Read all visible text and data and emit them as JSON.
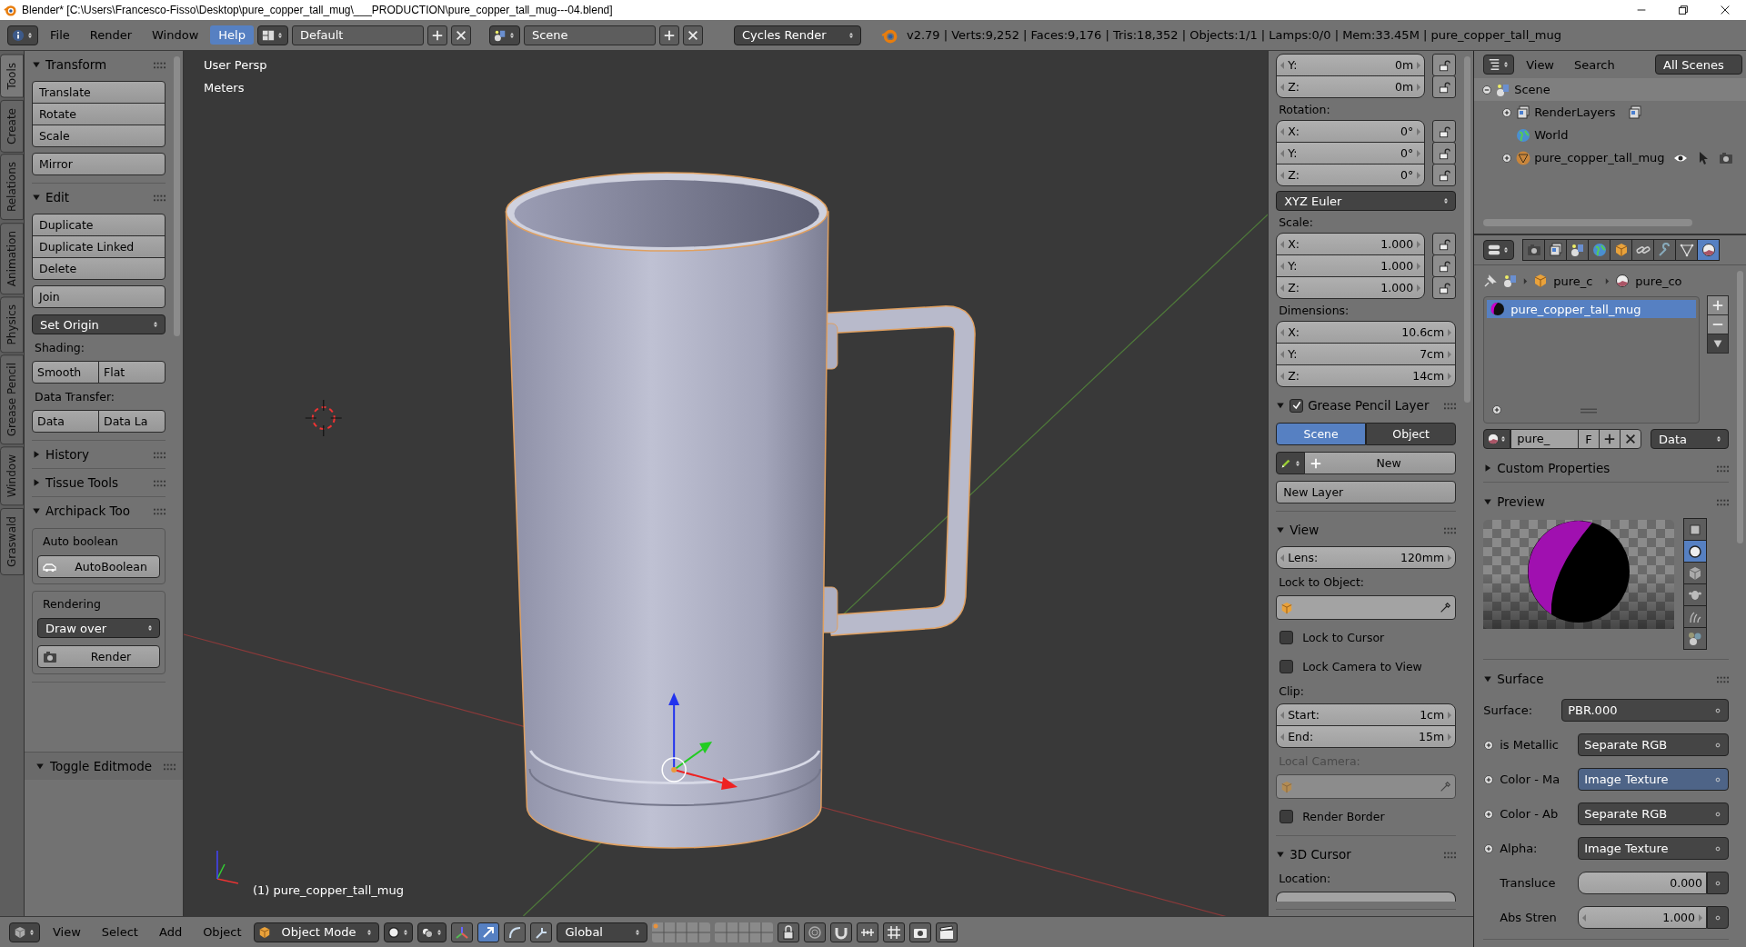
{
  "window": {
    "title": "Blender* [C:\\Users\\Francesco-Fisso\\Desktop\\pure_copper_tall_mug\\___PRODUCTION\\pure_copper_tall_mug---04.blend]"
  },
  "info_header": {
    "menus": [
      {
        "label": "File",
        "selected": false
      },
      {
        "label": "Render",
        "selected": false
      },
      {
        "label": "Window",
        "selected": false
      },
      {
        "label": "Help",
        "selected": true
      }
    ],
    "layout": "Default",
    "scene": "Scene",
    "engine": "Cycles Render",
    "stats": "v2.79 | Verts:9,252 | Faces:9,176 | Tris:18,352 | Objects:1/1 | Lamps:0/0 | Mem:33.45M | pure_copper_tall_mug"
  },
  "tool_tabs": [
    {
      "label": "Tools",
      "selected": true
    },
    {
      "label": "Create",
      "selected": false
    },
    {
      "label": "Relations",
      "selected": false
    },
    {
      "label": "Animation",
      "selected": false
    },
    {
      "label": "Physics",
      "selected": false
    },
    {
      "label": "Grease Pencil",
      "selected": false
    },
    {
      "label": "Window",
      "selected": false
    },
    {
      "label": "Graswald",
      "selected": false
    }
  ],
  "tool_shelf": {
    "panels": [
      {
        "title": "Transform",
        "expanded": true,
        "items": [
          {
            "kind": "stack",
            "buttons": [
              "Translate",
              "Rotate",
              "Scale"
            ]
          },
          {
            "kind": "stack",
            "buttons": [
              "Mirror"
            ]
          }
        ]
      },
      {
        "title": "Edit",
        "expanded": true,
        "items": [
          {
            "kind": "stack",
            "buttons": [
              "Duplicate",
              "Duplicate Linked",
              "Delete"
            ]
          },
          {
            "kind": "stack",
            "buttons": [
              "Join"
            ]
          },
          {
            "kind": "dropdown",
            "label": "Set Origin"
          },
          {
            "kind": "label",
            "label": "Shading:"
          },
          {
            "kind": "row",
            "buttons": [
              "Smooth",
              "Flat"
            ]
          },
          {
            "kind": "label",
            "label": "Data Transfer:"
          },
          {
            "kind": "row",
            "buttons": [
              "Data",
              "Data La"
            ]
          }
        ]
      },
      {
        "title": "History",
        "expanded": false
      },
      {
        "title": "Tissue Tools",
        "expanded": false
      },
      {
        "title": "Archipack Too",
        "expanded": true,
        "items": [
          {
            "kind": "box",
            "items": [
              {
                "kind": "label",
                "label": "Auto boolean"
              },
              {
                "kind": "icon_button",
                "label": "AutoBoolean"
              }
            ]
          },
          {
            "kind": "box",
            "items": [
              {
                "kind": "label",
                "label": "Rendering"
              },
              {
                "kind": "dropdown",
                "label": "Draw over"
              },
              {
                "kind": "icon_button",
                "label": "Render"
              }
            ]
          }
        ]
      }
    ]
  },
  "operator_panel": {
    "title": "Toggle Editmode",
    "expanded": true
  },
  "viewport": {
    "view_name": "User Persp",
    "units": "Meters",
    "object_label": "(1) pure_copper_tall_mug"
  },
  "properties_region": {
    "transform_items": [
      {
        "kind": "fields",
        "fields": [
          {
            "label": "Y:",
            "value": "0m",
            "locked": false
          },
          {
            "label": "Z:",
            "value": "0m",
            "locked": false
          }
        ]
      },
      {
        "kind": "label",
        "label": "Rotation:",
        "disabled": false
      },
      {
        "kind": "fields",
        "fields": [
          {
            "label": "X:",
            "value": "0°",
            "locked": false
          },
          {
            "label": "Y:",
            "value": "0°",
            "locked": false
          },
          {
            "label": "Z:",
            "value": "0°",
            "locked": false
          }
        ]
      },
      {
        "kind": "dropdown",
        "label": "XYZ Euler"
      },
      {
        "kind": "label",
        "label": "Scale:",
        "disabled": false
      },
      {
        "kind": "fields",
        "fields": [
          {
            "label": "X:",
            "value": "1.000",
            "locked": false
          },
          {
            "label": "Y:",
            "value": "1.000",
            "locked": false
          },
          {
            "label": "Z:",
            "value": "1.000",
            "locked": false
          }
        ]
      },
      {
        "kind": "label",
        "label": "Dimensions:",
        "disabled": false
      },
      {
        "kind": "fields",
        "fields": [
          {
            "label": "X:",
            "value": "10.6cm"
          },
          {
            "label": "Y:",
            "value": "7cm"
          },
          {
            "label": "Z:",
            "value": "14cm"
          }
        ]
      }
    ],
    "panels": [
      {
        "title": "Grease Pencil Layer",
        "expanded": true,
        "checked": true,
        "items": [
          {
            "kind": "toggle",
            "options": [
              {
                "label": "Scene",
                "selected": true
              },
              {
                "label": "Object",
                "selected": false
              }
            ]
          },
          {
            "kind": "new_row",
            "label": "New"
          },
          {
            "kind": "button",
            "label": "New Layer"
          }
        ]
      },
      {
        "title": "View",
        "expanded": true,
        "items": [
          {
            "kind": "fields",
            "fields": [
              {
                "label": "Lens:",
                "value": "120mm"
              }
            ]
          },
          {
            "kind": "label",
            "label": "Lock to Object:",
            "disabled": false
          },
          {
            "kind": "object_field",
            "disabled": false
          },
          {
            "kind": "checkbox",
            "label": "Lock to Cursor",
            "checked": false
          },
          {
            "kind": "checkbox",
            "label": "Lock Camera to View",
            "checked": false
          },
          {
            "kind": "label",
            "label": "Clip:",
            "disabled": false
          },
          {
            "kind": "fields",
            "fields": [
              {
                "label": "Start:",
                "value": "1cm"
              },
              {
                "label": "End:",
                "value": "15m"
              }
            ]
          },
          {
            "kind": "label",
            "label": "Local Camera:",
            "disabled": true
          },
          {
            "kind": "object_field",
            "disabled": true
          },
          {
            "kind": "checkbox",
            "label": "Render Border",
            "checked": false
          }
        ]
      },
      {
        "title": "3D Cursor",
        "expanded": true,
        "items": [
          {
            "kind": "label",
            "label": "Location:",
            "disabled": false
          },
          {
            "kind": "stub"
          }
        ]
      }
    ]
  },
  "outliner": {
    "menus": [
      "View",
      "Search"
    ],
    "filter": "All Scenes",
    "tree": [
      {
        "label": "Scene",
        "kind": "scene",
        "expanded": true,
        "selected": true,
        "children": [
          {
            "label": "RenderLayers",
            "kind": "render_layers",
            "expanded": false,
            "selected": false
          },
          {
            "label": "World",
            "kind": "world",
            "selected": false
          },
          {
            "label": "pure_copper_tall_mug",
            "kind": "mesh",
            "expanded": false,
            "selected": false
          }
        ]
      }
    ]
  },
  "properties": {
    "tabs": [
      {
        "kind": "render",
        "selected": false
      },
      {
        "kind": "render_layers",
        "selected": false
      },
      {
        "kind": "scene",
        "selected": false
      },
      {
        "kind": "world",
        "selected": false
      },
      {
        "kind": "object",
        "selected": false
      },
      {
        "kind": "constraints",
        "selected": false
      },
      {
        "kind": "modifiers",
        "selected": false
      },
      {
        "kind": "data",
        "selected": false
      },
      {
        "kind": "material",
        "selected": true
      }
    ],
    "breadcrumb": [
      "pure_c",
      "pure_co"
    ],
    "slots": [
      {
        "label": "pure_copper_tall_mug",
        "selected": true
      }
    ],
    "datablock": {
      "name": "pure_",
      "users": "F",
      "link": "Data"
    },
    "panels": [
      {
        "title": "Custom Properties",
        "expanded": false
      },
      {
        "kind": "preview",
        "title": "Preview",
        "expanded": true,
        "shapes": [
          {
            "kind": "flat",
            "selected": false
          },
          {
            "kind": "sphere",
            "selected": true
          },
          {
            "kind": "cube",
            "selected": false
          },
          {
            "kind": "monkey",
            "selected": false
          },
          {
            "kind": "hair",
            "selected": false
          },
          {
            "kind": "spheres",
            "selected": false
          }
        ]
      },
      {
        "kind": "surface",
        "title": "Surface",
        "expanded": true,
        "shader_label": "Surface:",
        "shader": "PBR.000",
        "inputs": [
          {
            "kind": "link",
            "label": "is Metallic",
            "value": "Separate RGB",
            "highlighted": false
          },
          {
            "kind": "link",
            "label": "Color - Ma",
            "value": "Image Texture",
            "highlighted": true
          },
          {
            "kind": "link",
            "label": "Color - Ab",
            "value": "Separate RGB",
            "highlighted": false
          },
          {
            "kind": "link",
            "label": "Alpha:",
            "value": "Image Texture",
            "highlighted": false
          },
          {
            "kind": "slider",
            "label": "Transluce",
            "value": "0.000"
          },
          {
            "kind": "number",
            "label": "Abs Stren",
            "value": "1.000"
          }
        ]
      }
    ]
  },
  "view_header": {
    "menus": [
      "View",
      "Select",
      "Add",
      "Object"
    ],
    "mode": "Object Mode",
    "orientation": "Global"
  }
}
